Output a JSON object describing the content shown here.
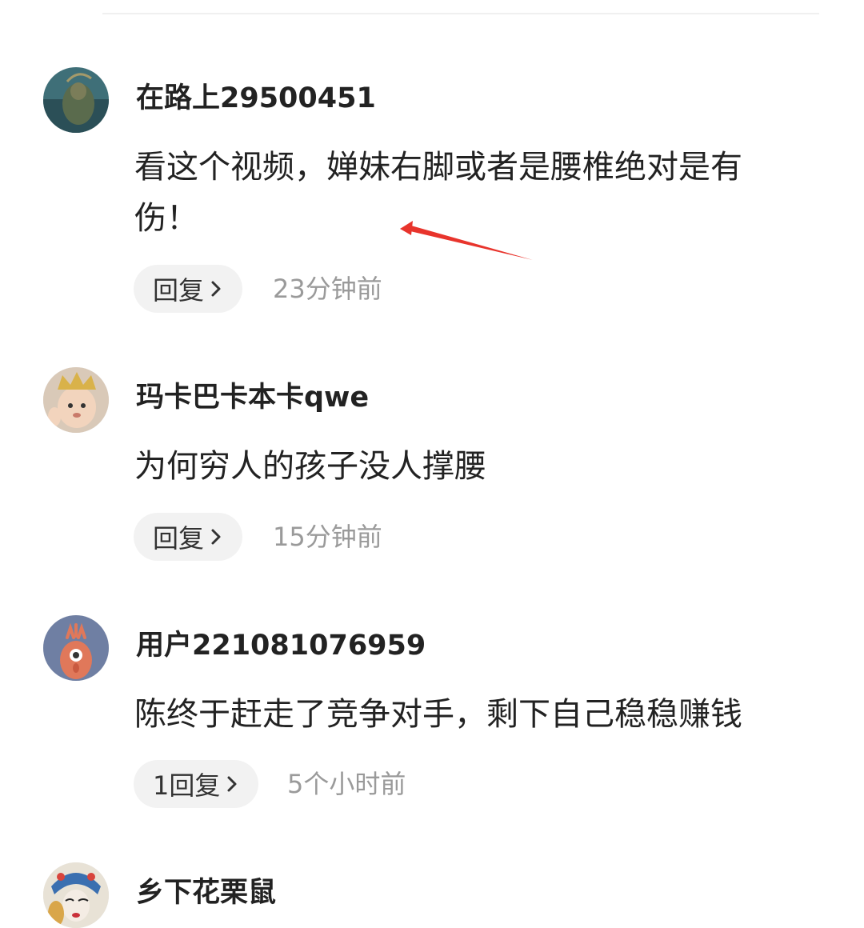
{
  "comments": [
    {
      "username": "在路上29500451",
      "text": "看这个视频，婵妹右脚或者是腰椎绝对是有伤！",
      "reply_label": "回复",
      "time": "23分钟前"
    },
    {
      "username": "玛卡巴卡本卡qwe",
      "text": "为何穷人的孩子没人撑腰",
      "reply_label": "回复",
      "time": "15分钟前"
    },
    {
      "username": "用户221081076959",
      "text": "陈终于赶走了竞争对手，剩下自己稳稳赚钱",
      "reply_label": "1回复",
      "time": "5个小时前"
    },
    {
      "username": "乡下花栗鼠"
    }
  ],
  "icons": {
    "reply_chevron": "chevron-right-icon",
    "annotation": "red-arrow-annotation"
  },
  "colors": {
    "reply_bg": "#f2f2f2",
    "timestamp": "#9a9a9a",
    "annotation": "#e8342c"
  }
}
